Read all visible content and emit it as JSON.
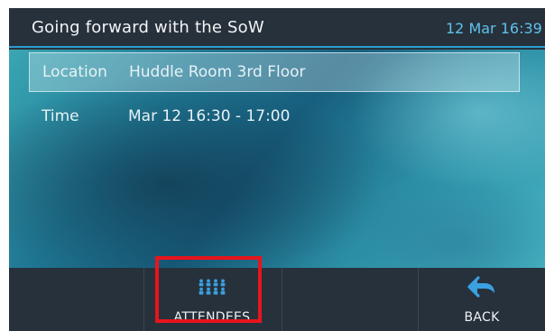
{
  "header": {
    "title": "Going forward with the SoW",
    "datetime": "12 Mar 16:39"
  },
  "details": [
    {
      "label": "Location",
      "value": "Huddle Room 3rd Floor",
      "selected": true
    },
    {
      "label": "Time",
      "value": "Mar 12 16:30 - 17:00",
      "selected": false
    }
  ],
  "softkeys": {
    "attendees": {
      "label": "ATTENDEES",
      "icon": "attendees-icon",
      "highlighted": true
    },
    "back": {
      "label": "BACK",
      "icon": "back-arrow-icon"
    }
  },
  "colors": {
    "accent": "#2a9ed0",
    "icon_blue": "#3aa0e0",
    "highlight_red": "#e8141c",
    "bar_background": "#27313b"
  }
}
